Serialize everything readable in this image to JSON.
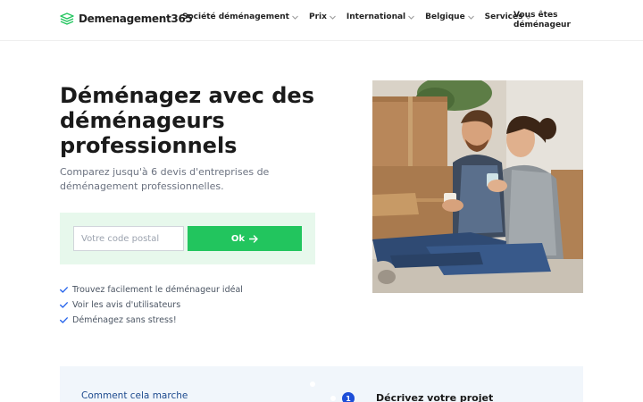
{
  "header": {
    "logo_text": "Demenagement365",
    "nav": [
      {
        "label": "Société déménagement",
        "icon": "chevron-down-icon"
      },
      {
        "label": "Prix",
        "icon": "chevron-down-icon"
      },
      {
        "label": "International",
        "icon": "chevron-down-icon"
      },
      {
        "label": "Belgique",
        "icon": "chevron-down-icon"
      },
      {
        "label": "Services",
        "icon": "chevron-down-icon"
      }
    ],
    "cta_line1": "Vous êtes",
    "cta_line2": "déménageur"
  },
  "hero": {
    "title": "Déménagez avec des déménageurs professionnels",
    "subtitle": "Comparez jusqu'à 6 devis d'entreprises de déménagement professionnelles.",
    "postal_placeholder": "Votre code postal",
    "postal_value": "",
    "ok_label": "Ok",
    "checklist": [
      "Trouvez facilement le déménageur idéal",
      "Voir les avis d'utilisateurs",
      "Déménagez sans stress!"
    ]
  },
  "how": {
    "title": "Comment cela marche",
    "step_number": "1",
    "step_label": "Décrivez votre projet"
  },
  "colors": {
    "accent_green": "#22c55e",
    "form_bg": "#e7f8ec",
    "how_bg": "#f1f6fb",
    "step_blue": "#1d4ed8"
  }
}
